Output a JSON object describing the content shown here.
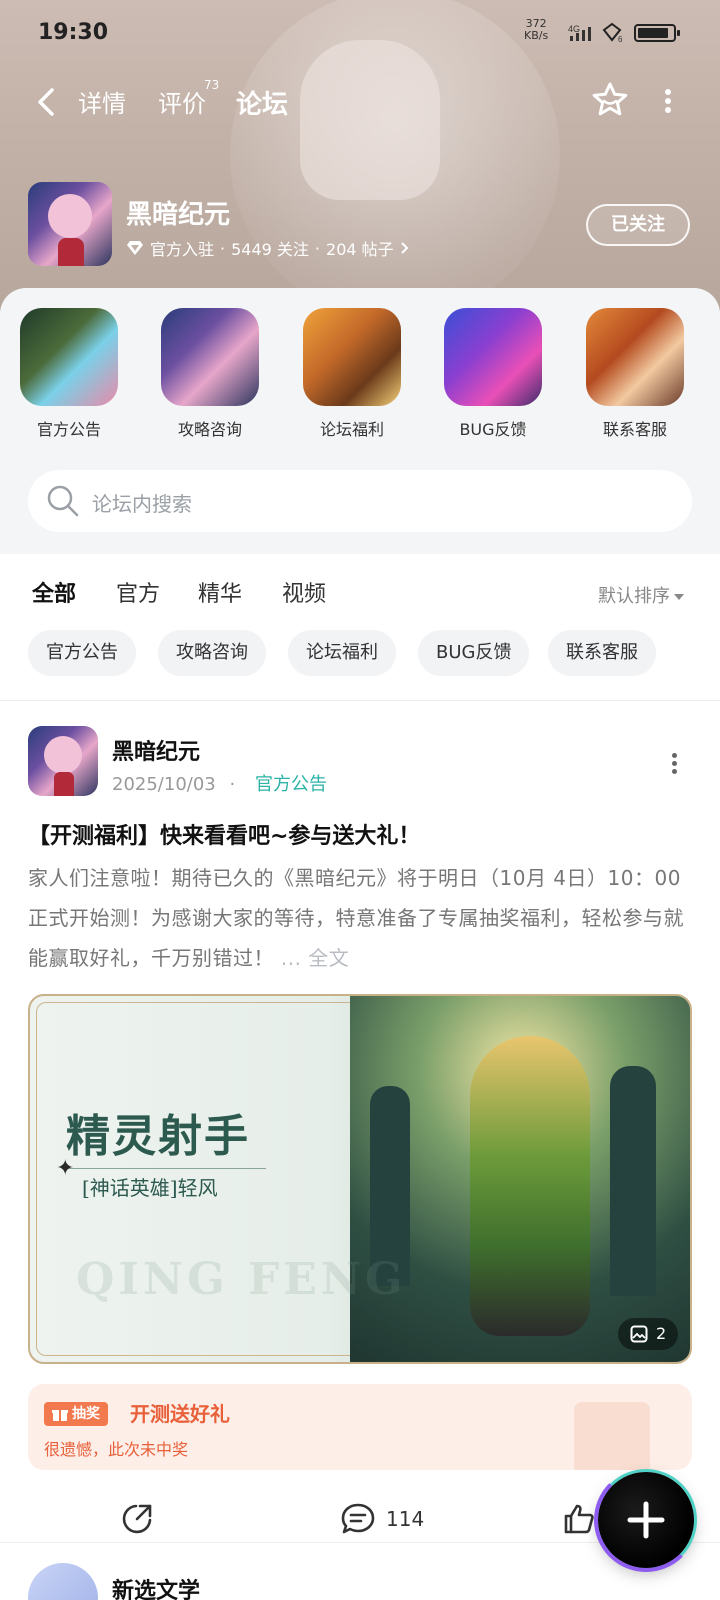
{
  "status_bar": {
    "time": "19:30",
    "speed_value": "372",
    "speed_unit": "KB/s",
    "network": "4G",
    "wifi_sub": "6"
  },
  "nav": {
    "tabs": [
      {
        "label": "详情"
      },
      {
        "label": "评价",
        "badge": "73"
      },
      {
        "label": "论坛"
      }
    ],
    "active_tab": "论坛"
  },
  "game": {
    "name": "黑暗纪元",
    "official": "官方入驻",
    "followers": "5449 关注",
    "posts": "204 帖子",
    "separator": "·",
    "follow_label": "已关注"
  },
  "categories": [
    {
      "label": "官方公告"
    },
    {
      "label": "攻略咨询"
    },
    {
      "label": "论坛福利"
    },
    {
      "label": "BUG反馈"
    },
    {
      "label": "联系客服"
    }
  ],
  "search": {
    "placeholder": "论坛内搜索"
  },
  "filter_tabs": [
    {
      "label": "全部"
    },
    {
      "label": "官方"
    },
    {
      "label": "精华"
    },
    {
      "label": "视频"
    }
  ],
  "sort_label": "默认排序",
  "chips": [
    {
      "label": "官方公告"
    },
    {
      "label": "攻略咨询"
    },
    {
      "label": "论坛福利"
    },
    {
      "label": "BUG反馈"
    },
    {
      "label": "联系客服"
    }
  ],
  "post": {
    "author": "黑暗纪元",
    "date": "2025/10/03",
    "dot": "·",
    "category": "官方公告",
    "title": "【开测福利】快来看看吧~参与送大礼！",
    "body": "家人们注意啦！期待已久的《黑暗纪元》将于明日（10月 4日）10：00 正式开始测！为感谢大家的等待，特意准备了专属抽奖福利，轻松参与就能赢取好礼，千万别错过！",
    "more_label": "... 全文",
    "image": {
      "title": "精灵射手",
      "subtitle": "[神话英雄]轻风",
      "watermark": "QING FENG",
      "count": "2"
    },
    "lottery": {
      "tag": "抽奖",
      "title": "开测送好礼",
      "subtitle": "很遗憾，此次未中奖"
    },
    "comments": "114"
  },
  "next_post": {
    "author": "新选文学"
  },
  "colors": {
    "accent": "#39c5b8",
    "lottery": "#e8603a"
  }
}
